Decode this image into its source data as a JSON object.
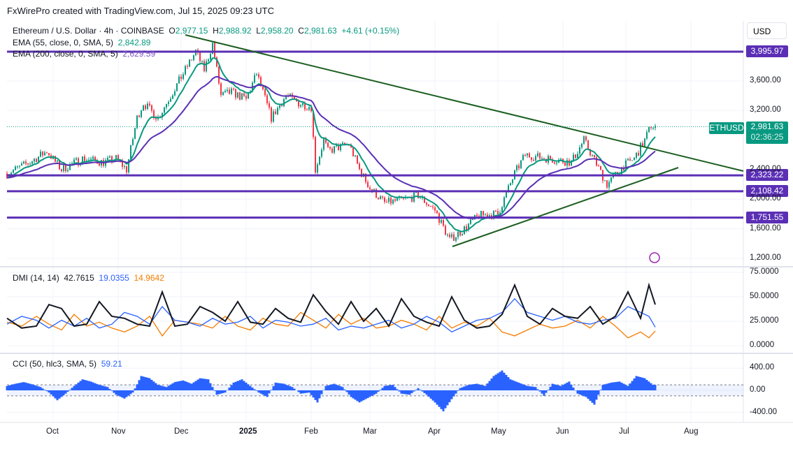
{
  "header": "FxWirePro created with TradingView.com, Jul 15, 2025 09:23 UTC",
  "legend": {
    "symbol": "Ethereum / U.S. Dollar · 4h · COINBASE",
    "o_label": "O",
    "o": "2,977.15",
    "h_label": "H",
    "h": "2,988.92",
    "l_label": "L",
    "l": "2,958.20",
    "c_label": "C",
    "c": "2,981.63",
    "change": "+4.61 (+0.15%)",
    "ema55_label": "EMA (55, close, 0, SMA, 5)",
    "ema55": "2,842.89",
    "ema200_label": "EMA (200, close, 0, SMA, 5)",
    "ema200": "2,629.59",
    "dmi_label": "DMI (14, 14)",
    "dmi_adx": "42.7615",
    "dmi_plus": "19.0355",
    "dmi_minus": "14.9642",
    "cci_label": "CCI (50, hlc3, SMA, 5)",
    "cci": "59.21"
  },
  "currency": "USD",
  "price_tag": {
    "symbol": "ETHUSD",
    "price": "2,981.63",
    "countdown": "02:36:25"
  },
  "levels": [
    {
      "value": 3995.97,
      "label": "3,995.97"
    },
    {
      "value": 2323.22,
      "label": "2,323.22"
    },
    {
      "value": 2108.42,
      "label": "2,108.42"
    },
    {
      "value": 1751.55,
      "label": "1,751.55"
    }
  ],
  "colors": {
    "up": "#089981",
    "down": "#f23645",
    "level": "#5b2fb5",
    "trend": "#1b5e20",
    "ema55": "#089981",
    "ema200": "#5b2fb5",
    "adx": "#131722",
    "plus": "#2962ff",
    "minus": "#f57c00",
    "cci": "#2962ff"
  },
  "chart_data": {
    "type": "line",
    "title": "Ethereum / U.S. Dollar 4h",
    "x_unit": "days since 2024-10-01",
    "price_axis": {
      "ticks": [
        "3,600.00",
        "3,200.00",
        "2,400.00",
        "2,000.00",
        "1,600.00",
        "1,200.00"
      ],
      "tick_values": [
        3600,
        3200,
        2400,
        2000,
        1600,
        1200
      ],
      "ylim": [
        1200,
        3995.97
      ]
    },
    "time_axis": {
      "labels": [
        "Oct",
        "Nov",
        "Dec",
        "2025",
        "Feb",
        "Mar",
        "Apr",
        "May",
        "Jun",
        "Jul",
        "Aug"
      ],
      "days": [
        0,
        31,
        61,
        92,
        123,
        151,
        182,
        212,
        243,
        273,
        304
      ]
    },
    "price": [
      [
        -22,
        2350
      ],
      [
        -11,
        2500
      ],
      [
        -3,
        2650
      ],
      [
        4,
        2400
      ],
      [
        14,
        2550
      ],
      [
        24,
        2500
      ],
      [
        30,
        2550
      ],
      [
        35,
        2400
      ],
      [
        40,
        3100
      ],
      [
        43,
        3300
      ],
      [
        50,
        3100
      ],
      [
        60,
        3600
      ],
      [
        68,
        4000
      ],
      [
        72,
        3750
      ],
      [
        76,
        4100
      ],
      [
        80,
        3400
      ],
      [
        85,
        3450
      ],
      [
        92,
        3350
      ],
      [
        97,
        3700
      ],
      [
        104,
        3100
      ],
      [
        111,
        3400
      ],
      [
        117,
        3300
      ],
      [
        123,
        3250
      ],
      [
        125,
        2400
      ],
      [
        129,
        2800
      ],
      [
        131,
        2650
      ],
      [
        141,
        2750
      ],
      [
        146,
        2400
      ],
      [
        151,
        2150
      ],
      [
        158,
        1950
      ],
      [
        168,
        2000
      ],
      [
        174,
        2050
      ],
      [
        182,
        1850
      ],
      [
        189,
        1450
      ],
      [
        196,
        1600
      ],
      [
        203,
        1780
      ],
      [
        212,
        1800
      ],
      [
        220,
        2350
      ],
      [
        225,
        2600
      ],
      [
        236,
        2550
      ],
      [
        247,
        2500
      ],
      [
        253,
        2800
      ],
      [
        264,
        2200
      ],
      [
        272,
        2450
      ],
      [
        277,
        2550
      ],
      [
        282,
        2800
      ],
      [
        285,
        3000
      ],
      [
        287,
        2981.63
      ]
    ],
    "trendlines": [
      {
        "from": [
          41,
          4150
        ],
        "to": [
          307,
          2300
        ]
      },
      {
        "from": [
          190,
          1400
        ],
        "to": [
          298,
          2480
        ]
      }
    ],
    "dmi": {
      "ylim": [
        0,
        75
      ],
      "ticks": [
        "75.0000",
        "50.0000",
        "25.0000",
        "0.0000"
      ],
      "tick_values": [
        75,
        50,
        25,
        0
      ],
      "days": [
        -22,
        -15,
        -8,
        -2,
        4,
        10,
        16,
        22,
        28,
        34,
        40,
        46,
        52,
        58,
        64,
        70,
        76,
        82,
        88,
        94,
        100,
        106,
        112,
        118,
        124,
        130,
        136,
        142,
        148,
        154,
        160,
        166,
        172,
        178,
        184,
        190,
        196,
        202,
        208,
        214,
        220,
        226,
        232,
        238,
        244,
        250,
        256,
        262,
        268,
        274,
        280,
        284,
        287
      ],
      "adx": [
        28,
        18,
        20,
        42,
        38,
        20,
        22,
        45,
        30,
        28,
        22,
        20,
        55,
        20,
        22,
        40,
        34,
        25,
        45,
        24,
        22,
        38,
        28,
        24,
        52,
        35,
        22,
        45,
        25,
        38,
        20,
        48,
        30,
        24,
        20,
        50,
        26,
        18,
        20,
        32,
        62,
        30,
        22,
        38,
        30,
        28,
        40,
        22,
        30,
        55,
        28,
        62,
        42
      ],
      "plus": [
        22,
        30,
        26,
        18,
        26,
        20,
        28,
        18,
        22,
        34,
        30,
        22,
        40,
        26,
        24,
        20,
        28,
        22,
        24,
        30,
        18,
        26,
        24,
        20,
        22,
        28,
        16,
        20,
        18,
        22,
        26,
        18,
        22,
        30,
        24,
        14,
        20,
        26,
        28,
        34,
        48,
        34,
        30,
        26,
        30,
        24,
        22,
        26,
        28,
        40,
        34,
        30,
        19
      ],
      "minus": [
        24,
        20,
        30,
        22,
        16,
        32,
        20,
        24,
        18,
        14,
        20,
        30,
        10,
        26,
        24,
        22,
        18,
        30,
        20,
        16,
        28,
        22,
        20,
        34,
        26,
        18,
        32,
        22,
        28,
        18,
        20,
        26,
        22,
        16,
        30,
        18,
        24,
        20,
        28,
        14,
        10,
        16,
        22,
        18,
        20,
        26,
        18,
        30,
        20,
        8,
        14,
        8,
        15
      ]
    },
    "cci": {
      "ylim": [
        -500,
        500
      ],
      "ticks": [
        "400.00",
        "0.00",
        "-400.00"
      ],
      "tick_values": [
        400,
        0,
        -400
      ],
      "band": [
        100,
        -100
      ],
      "days": [
        -22,
        -18,
        -14,
        -10,
        -6,
        -2,
        2,
        6,
        10,
        14,
        18,
        22,
        26,
        30,
        34,
        38,
        42,
        46,
        50,
        54,
        58,
        62,
        66,
        70,
        74,
        78,
        82,
        86,
        90,
        94,
        98,
        102,
        106,
        110,
        114,
        118,
        122,
        126,
        130,
        134,
        138,
        142,
        146,
        150,
        154,
        158,
        162,
        166,
        170,
        174,
        178,
        182,
        186,
        190,
        194,
        198,
        202,
        206,
        210,
        214,
        218,
        222,
        226,
        230,
        234,
        238,
        242,
        246,
        250,
        254,
        258,
        262,
        266,
        270,
        274,
        278,
        282,
        286
      ],
      "values": [
        80,
        120,
        150,
        110,
        60,
        -40,
        -180,
        -60,
        80,
        200,
        160,
        100,
        60,
        -80,
        -150,
        -40,
        260,
        220,
        100,
        60,
        150,
        180,
        120,
        220,
        200,
        -80,
        -40,
        140,
        200,
        80,
        -40,
        -120,
        140,
        120,
        60,
        -60,
        -40,
        -220,
        80,
        120,
        60,
        -120,
        -220,
        -140,
        -60,
        80,
        100,
        -60,
        -80,
        40,
        -80,
        -220,
        -380,
        -160,
        40,
        100,
        120,
        80,
        260,
        360,
        200,
        140,
        80,
        60,
        -100,
        120,
        80,
        160,
        -60,
        -120,
        -260,
        100,
        140,
        160,
        80,
        260,
        220,
        100
      ]
    }
  }
}
